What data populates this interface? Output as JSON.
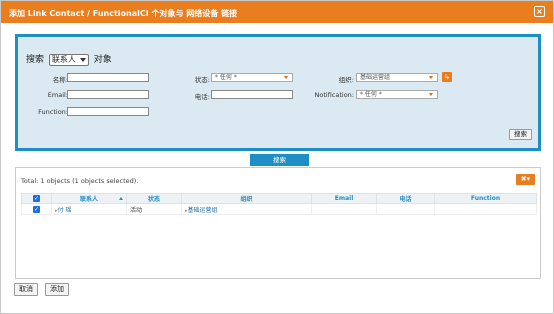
{
  "dialog": {
    "title": "添加 Link Contact / FunctionalCI 个对象与 网络设备 链接",
    "close": "×"
  },
  "search": {
    "prefix": "搜索",
    "class_value": "联系人",
    "suffix": "对象",
    "fields": {
      "name_label": "名称:",
      "email_label": "Email:",
      "function_label": "Function:",
      "status_label": "状态:",
      "status_value": "* 任何 *",
      "phone_label": "电话:",
      "org_label": "组织:",
      "org_value": "基础运营组",
      "notification_label": "Notification:",
      "notification_value": "* 任何 *"
    },
    "search_button": "搜索",
    "toggle_label": "搜索"
  },
  "results": {
    "total_text": "Total: 1 objects (1 objects selected).",
    "tools_icon": "✖▾",
    "columns": [
      "联系人",
      "状态",
      "组织",
      "Email",
      "电话",
      "Function"
    ],
    "rows": [
      {
        "name": "付 瑶",
        "status": "活动",
        "org": "基础运营组",
        "email": "",
        "phone": "",
        "function": ""
      }
    ]
  },
  "footer": {
    "cancel": "取消",
    "add": "添加"
  },
  "colors": {
    "accent_orange": "#ea7d1e",
    "accent_blue": "#1e8fc4",
    "panel_bg": "#dbeaf2"
  }
}
